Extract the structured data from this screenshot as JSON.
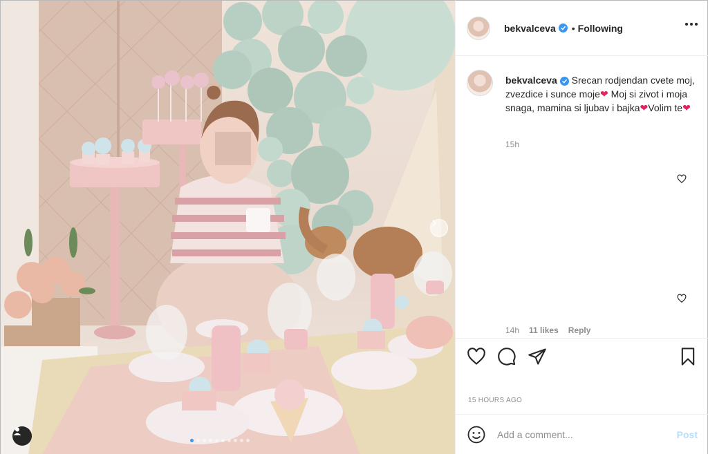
{
  "post": {
    "username": "bekvalceva",
    "separator": "•",
    "follow_status": "Following",
    "caption": {
      "part1": "Srecan rodjendan cvete moj, zvezdice i sunce moje",
      "part2": "Moj si zivot i moja snaga, mamina si ljubav i bajka",
      "part3": "Volim te",
      "emoji": "❤",
      "time": "15h"
    },
    "comment_meta": {
      "time": "14h",
      "likes": "11 likes",
      "reply": "Reply"
    },
    "timestamp": "15 HOURS AGO",
    "comment_placeholder": "Add a comment...",
    "post_label": "Post"
  },
  "carousel": {
    "total": 10,
    "current": 1
  },
  "colors": {
    "accent": "#3897f0",
    "post_disabled": "#b2dffc",
    "heart": "#e0245e"
  },
  "icons": [
    "user-tag-icon",
    "chevron-right-icon",
    "verified-badge-icon",
    "more-options-icon",
    "heart-icon",
    "comment-icon",
    "share-icon",
    "save-icon",
    "emoji-icon"
  ]
}
